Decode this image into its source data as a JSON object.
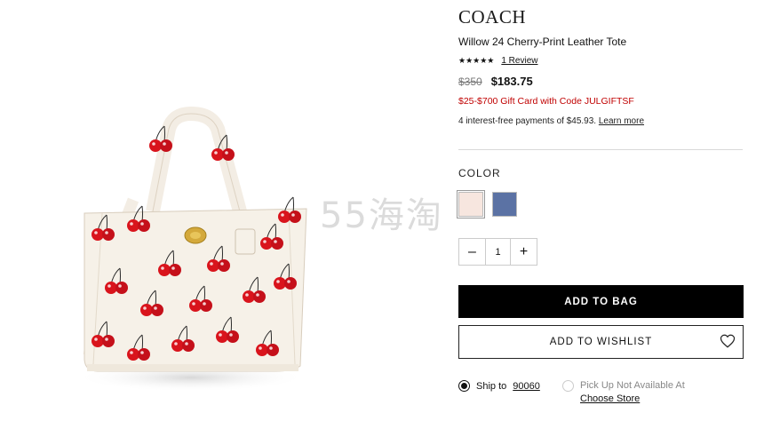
{
  "product": {
    "brand": "COACH",
    "title": "Willow 24 Cherry-Print Leather Tote",
    "stars": "★★★★★",
    "review_link": "1 Review",
    "old_price": "$350",
    "new_price": "$183.75",
    "promo": "$25-$700 Gift Card with Code JULGIFTSF",
    "installments": "4 interest-free payments of $45.93.",
    "learn_more": "Learn more"
  },
  "color": {
    "label": "COLOR",
    "swatches": [
      {
        "name": "Chalk",
        "hex": "#f7e6df"
      },
      {
        "name": "Blue",
        "hex": "#5b72a4"
      }
    ]
  },
  "quantity": {
    "minus": "–",
    "value": "1",
    "plus": "+"
  },
  "buttons": {
    "add_to_bag": "ADD TO BAG",
    "add_to_wishlist": "ADD TO WISHLIST"
  },
  "fulfillment": {
    "ship_label": "Ship to",
    "zip": "90060",
    "pickup_label": "Pick Up Not Available At",
    "choose_store": "Choose Store"
  },
  "watermark": "55海淘",
  "colors": {
    "promo_red": "#c00000",
    "cherry": "#d9141c",
    "bag_base": "#f6f1e8"
  }
}
